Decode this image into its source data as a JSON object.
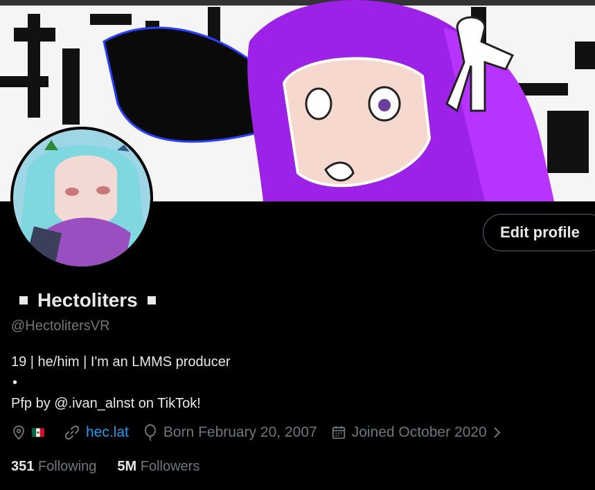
{
  "profile": {
    "edit_button": "Edit profile",
    "display_name": "Hectoliters",
    "handle": "@HectolitersVR",
    "bio_line1": "19 | he/him | I'm an LMMS producer",
    "bio_dot": "•",
    "bio_line3": "Pfp by @.ivan_alnst on TikTok!",
    "website": "hec.lat",
    "born": "Born February 20, 2007",
    "joined": "Joined October 2020",
    "following_count": "351",
    "following_label": "Following",
    "followers_count": "5M",
    "followers_label": "Followers"
  },
  "icons": {
    "location": "location-pin-icon",
    "flag": "mexico-flag-icon",
    "link": "link-icon",
    "birthday": "balloon-icon",
    "calendar": "calendar-icon",
    "chevron": "chevron-right-icon"
  },
  "colors": {
    "background": "#000000",
    "text": "#e7e9ea",
    "muted": "#71767b",
    "link": "#1d9bf0",
    "banner_accent": "#a020f0"
  }
}
